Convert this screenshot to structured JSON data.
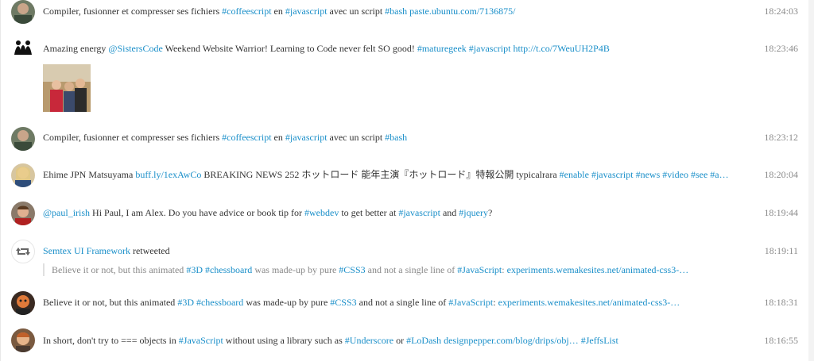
{
  "tweets": [
    {
      "parts": [
        {
          "t": "Compiler, fusionner et compresser ses fichiers "
        },
        {
          "t": "#coffeescript",
          "link": true
        },
        {
          "t": " en "
        },
        {
          "t": "#javascript",
          "link": true
        },
        {
          "t": " avec un script "
        },
        {
          "t": "#bash",
          "link": true
        },
        {
          "t": " "
        },
        {
          "t": "paste.ubuntu.com/7136875/",
          "link": true
        }
      ],
      "time": "18:24:03"
    },
    {
      "parts": [
        {
          "t": "Amazing energy "
        },
        {
          "t": "@SistersCode",
          "link": true
        },
        {
          "t": " Weekend Website Warrior! Learning to Code never felt SO good! "
        },
        {
          "t": "#maturegeek",
          "link": true
        },
        {
          "t": " "
        },
        {
          "t": "#javascript",
          "link": true
        },
        {
          "t": " "
        },
        {
          "t": "http://t.co/7WeuUH2P4B",
          "link": true
        }
      ],
      "time": "18:23:46"
    },
    {
      "parts": [
        {
          "t": "Compiler, fusionner et compresser ses fichiers "
        },
        {
          "t": "#coffeescript",
          "link": true
        },
        {
          "t": " en "
        },
        {
          "t": "#javascript",
          "link": true
        },
        {
          "t": " avec un script "
        },
        {
          "t": "#bash",
          "link": true
        }
      ],
      "time": "18:23:12"
    },
    {
      "parts": [
        {
          "t": "Ehime JPN Matsuyama "
        },
        {
          "t": "buff.ly/1exAwCo",
          "link": true
        },
        {
          "t": " BREAKING NEWS 252 ホットロード 能年主演『ホットロード』特報公開 typicalrara "
        },
        {
          "t": "#enable",
          "link": true
        },
        {
          "t": " "
        },
        {
          "t": "#javascript",
          "link": true
        },
        {
          "t": " "
        },
        {
          "t": "#news",
          "link": true
        },
        {
          "t": " "
        },
        {
          "t": "#video",
          "link": true
        },
        {
          "t": " "
        },
        {
          "t": "#see",
          "link": true
        },
        {
          "t": " "
        },
        {
          "t": "#a…",
          "link": true
        }
      ],
      "time": "18:20:04"
    },
    {
      "parts": [
        {
          "t": "@paul_irish",
          "link": true
        },
        {
          "t": " Hi Paul, I am Alex. Do you have advice or book tip for "
        },
        {
          "t": "#webdev",
          "link": true
        },
        {
          "t": " to get better at "
        },
        {
          "t": "#javascript",
          "link": true
        },
        {
          "t": " and "
        },
        {
          "t": "#jquery",
          "link": true
        },
        {
          "t": "?"
        }
      ],
      "time": "18:19:44"
    },
    {
      "parts": [
        {
          "t": "Semtex UI Framework",
          "link": true
        },
        {
          "t": " retweeted"
        }
      ],
      "quote": [
        {
          "t": "Believe it or not, but this animated "
        },
        {
          "t": "#3D",
          "link": true
        },
        {
          "t": " "
        },
        {
          "t": "#chessboard",
          "link": true
        },
        {
          "t": " was made-up by pure "
        },
        {
          "t": "#CSS3",
          "link": true
        },
        {
          "t": " and not a single line of "
        },
        {
          "t": "#JavaScript",
          "link": true
        },
        {
          "t": ": "
        },
        {
          "t": "experiments.wemakesites.net/animated-css3-…",
          "link": true
        }
      ],
      "time": "18:19:11"
    },
    {
      "parts": [
        {
          "t": "Believe it or not, but this animated "
        },
        {
          "t": "#3D",
          "link": true
        },
        {
          "t": " "
        },
        {
          "t": "#chessboard",
          "link": true
        },
        {
          "t": " was made-up by pure "
        },
        {
          "t": "#CSS3",
          "link": true
        },
        {
          "t": " and not a single line of "
        },
        {
          "t": "#JavaScript",
          "link": true
        },
        {
          "t": ": "
        },
        {
          "t": "experiments.wemakesites.net/animated-css3-…",
          "link": true
        }
      ],
      "time": "18:18:31"
    },
    {
      "parts": [
        {
          "t": "In short, don't try to === objects in "
        },
        {
          "t": "#JavaScript",
          "link": true
        },
        {
          "t": " without using a library such as "
        },
        {
          "t": "#Underscore",
          "link": true
        },
        {
          "t": " or "
        },
        {
          "t": "#LoDash",
          "link": true
        },
        {
          "t": " "
        },
        {
          "t": "designpepper.com/blog/drips/obj…",
          "link": true
        },
        {
          "t": " "
        },
        {
          "t": "#JeffsList",
          "link": true
        }
      ],
      "time": "18:16:55"
    }
  ],
  "colors": {
    "link": "#1a8fc9",
    "time": "#8a8a8a",
    "text": "#333333"
  },
  "icons": [
    "retweet-icon"
  ]
}
